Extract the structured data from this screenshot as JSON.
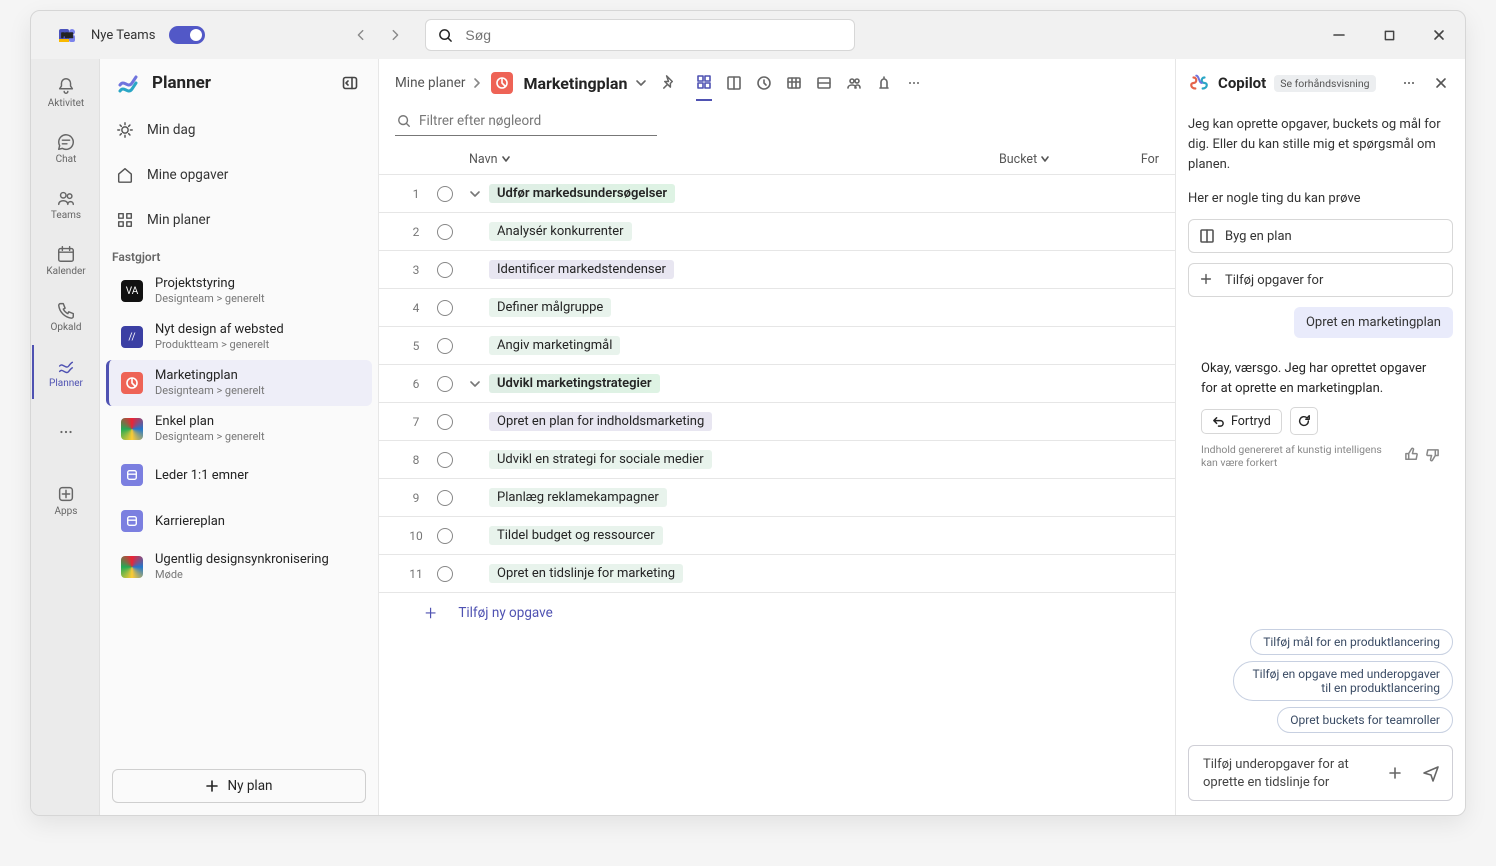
{
  "titlebar": {
    "app_name": "Nye Teams",
    "search_placeholder": "Søg"
  },
  "rail": {
    "items": [
      {
        "id": "activity",
        "label": "Aktivitet"
      },
      {
        "id": "chat",
        "label": "Chat"
      },
      {
        "id": "teams",
        "label": "Teams"
      },
      {
        "id": "calendar",
        "label": "Kalender"
      },
      {
        "id": "calls",
        "label": "Opkald"
      },
      {
        "id": "planner",
        "label": "Planner",
        "selected": true
      }
    ],
    "apps_label": "Apps"
  },
  "sidebar": {
    "title": "Planner",
    "nav": [
      {
        "id": "myday",
        "label": "Min dag"
      },
      {
        "id": "mytasks",
        "label": "Mine opgaver"
      },
      {
        "id": "myplans",
        "label": "Min planer"
      }
    ],
    "pinned_label": "Fastgjort",
    "plans": [
      {
        "name": "Projektstyring",
        "sub": "Designteam > generelt",
        "color": "#111",
        "glyph": "VA"
      },
      {
        "name": "Nyt design af websted",
        "sub": "Produktteam > generelt",
        "color": "#3b3fa3",
        "glyph": "//"
      },
      {
        "name": "Marketingplan",
        "sub": "Designteam > generelt",
        "color": "#ee6356",
        "selected": true
      },
      {
        "name": "Enkel plan",
        "sub": "Designteam > generelt",
        "color_css": "conic-gradient(#e23,#27c,#fc3,#2a5,#e23)"
      },
      {
        "name": "Leder 1:1 emner",
        "sub": "",
        "color": "#7b7fe0"
      },
      {
        "name": "Karriereplan",
        "sub": "",
        "color": "#7b7fe0"
      },
      {
        "name": "Ugentlig designsynkronisering",
        "sub": "Møde",
        "color_css": "conic-gradient(#e23,#27c,#fc3,#2a5,#e23)"
      }
    ],
    "new_plan": "Ny plan"
  },
  "main": {
    "breadcrumb_root": "Mine planer",
    "plan_title": "Marketingplan",
    "filter_placeholder": "Filtrer efter nøgleord",
    "headers": {
      "name": "Navn",
      "bucket": "Bucket",
      "for": "For"
    },
    "rows": [
      {
        "n": 1,
        "group": true,
        "label": "Udfør markedsundersøgelser"
      },
      {
        "n": 2,
        "label": "Analysér konkurrenter"
      },
      {
        "n": 3,
        "label": "Identificer markedstendenser",
        "alt": true
      },
      {
        "n": 4,
        "label": "Definer målgruppe"
      },
      {
        "n": 5,
        "label": "Angiv marketingmål"
      },
      {
        "n": 6,
        "group": true,
        "label": "Udvikl marketingstrategier"
      },
      {
        "n": 7,
        "label": "Opret en plan for indholdsmarketing",
        "alt": true
      },
      {
        "n": 8,
        "label": "Udvikl en strategi for sociale medier"
      },
      {
        "n": 9,
        "label": "Planlæg reklamekampagner"
      },
      {
        "n": 10,
        "label": "Tildel budget og ressourcer"
      },
      {
        "n": 11,
        "label": "Opret en tidslinje for marketing"
      }
    ],
    "add_task": "Tilføj ny opgave"
  },
  "copilot": {
    "title": "Copilot",
    "preview_badge": "Se forhåndsvisning",
    "intro": "Jeg kan oprette opgaver, buckets og mål for dig. Eller du kan stille mig et spørgsmål om planen.",
    "prompt_heading": "Her er nogle ting du kan prøve",
    "suggestions": [
      "Byg en plan",
      "Tilføj opgaver for"
    ],
    "user_message": "Opret en marketingplan",
    "ai_reply": "Okay, værsgo. Jeg har oprettet opgaver for at oprette en marketingplan.",
    "undo_label": "Fortryd",
    "disclaimer": "Indhold genereret af kunstig intelligens kan være forkert",
    "chips": [
      "Tilføj mål for en produktlancering",
      "Tilføj en opgave med underopgaver til en produktlancering",
      "Opret buckets for teamroller"
    ],
    "compose_text": "Tilføj underopgaver for at oprette en tidslinje for marketing"
  }
}
